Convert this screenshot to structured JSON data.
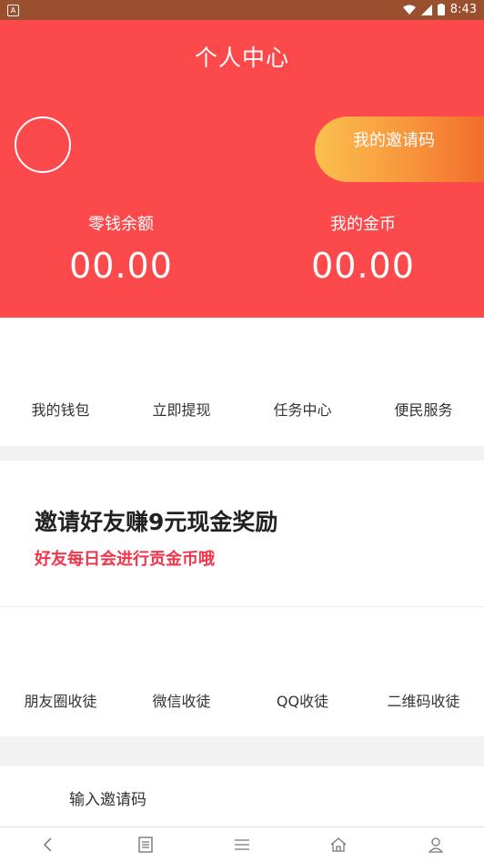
{
  "status_bar": {
    "time": "8:43",
    "app_icon": "A"
  },
  "header": {
    "title": "个人中心",
    "invite_code_label": "我的邀请码",
    "balance_label": "零钱余额",
    "balance_value": "00.00",
    "coins_label": "我的金币",
    "coins_value": "00.00"
  },
  "menu_primary": [
    {
      "label": "我的钱包"
    },
    {
      "label": "立即提现"
    },
    {
      "label": "任务中心"
    },
    {
      "label": "便民服务"
    }
  ],
  "invite_banner": {
    "headline": "邀请好友赚9元现金奖励",
    "subline": "好友每日会进行贡金币哦"
  },
  "menu_share": [
    {
      "label": "朋友圈收徒"
    },
    {
      "label": "微信收徒"
    },
    {
      "label": "QQ收徒"
    },
    {
      "label": "二维码收徒"
    }
  ],
  "enter_invite_code": {
    "label": "输入邀请码"
  },
  "bottom_nav_icons": [
    "back-icon",
    "list-icon",
    "menu-icon",
    "home-icon",
    "profile-icon"
  ],
  "colors": {
    "header_bg": "#fc4a4c",
    "status_bar_bg": "#9a4f2e",
    "invite_gradient_start": "#fbc04f",
    "invite_gradient_end": "#f26d2c",
    "subline_red": "#f2354a"
  }
}
